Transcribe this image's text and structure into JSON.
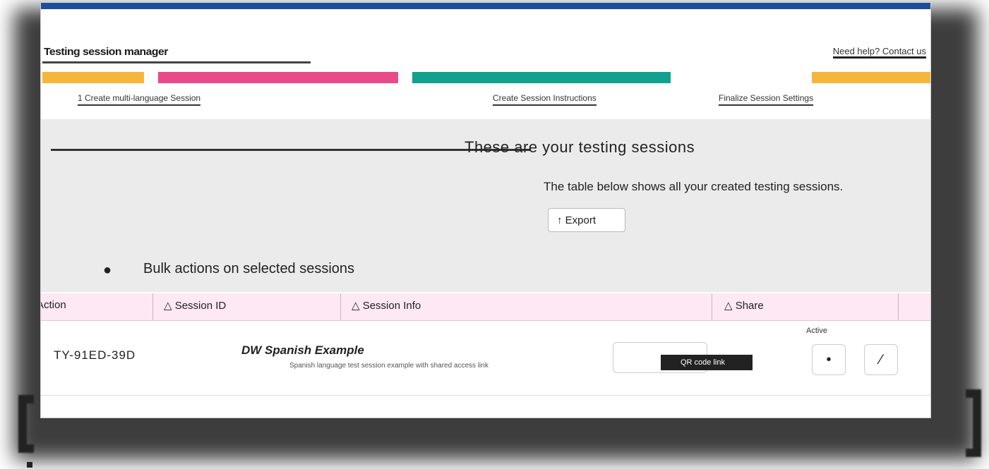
{
  "header": {
    "brand": "Testing session manager",
    "right_text": "Need help? Contact us"
  },
  "steps": [
    {
      "label": "1 Create multi-language Session",
      "color": "#f6b63e"
    },
    {
      "label": "",
      "color": "#e84a8a"
    },
    {
      "label": "Create Session Instructions",
      "color": "#12a08f"
    },
    {
      "label": "Finalize Session Settings",
      "color": "#f6b63e"
    }
  ],
  "main": {
    "heading": "These are your testing sessions",
    "subtext": "The table below shows all your created testing sessions.",
    "export_label": "↑ Export",
    "bulk_actions": "Bulk actions on selected sessions"
  },
  "table": {
    "columns": [
      "Action",
      "Session ID",
      "Session Info",
      "Share"
    ],
    "rows": [
      {
        "session_id": "TY-91ED-39D",
        "title": "DW Spanish Example",
        "description": "Spanish language test session example with shared access link",
        "share_label": "QR code link",
        "status": "Active"
      }
    ]
  }
}
